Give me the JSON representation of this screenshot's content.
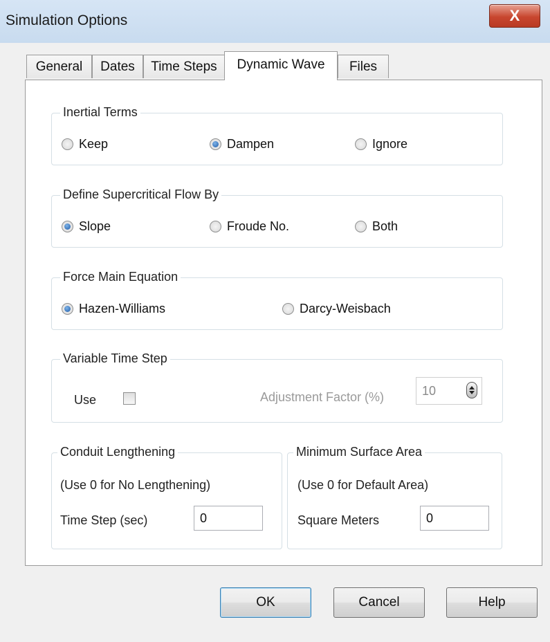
{
  "window": {
    "title": "Simulation Options",
    "close_label": "X"
  },
  "tabs": [
    {
      "label": "General",
      "active": false
    },
    {
      "label": "Dates",
      "active": false
    },
    {
      "label": "Time Steps",
      "active": false
    },
    {
      "label": "Dynamic Wave",
      "active": true
    },
    {
      "label": "Files",
      "active": false
    }
  ],
  "inertial_terms": {
    "label": "Inertial Terms",
    "options": [
      {
        "label": "Keep",
        "checked": false
      },
      {
        "label": "Dampen",
        "checked": true
      },
      {
        "label": "Ignore",
        "checked": false
      }
    ]
  },
  "supercritical": {
    "label": "Define Supercritical Flow By",
    "options": [
      {
        "label": "Slope",
        "checked": true
      },
      {
        "label": "Froude No.",
        "checked": false
      },
      {
        "label": "Both",
        "checked": false
      }
    ]
  },
  "force_main": {
    "label": "Force Main Equation",
    "options": [
      {
        "label": "Hazen-Williams",
        "checked": true
      },
      {
        "label": "Darcy-Weisbach",
        "checked": false
      }
    ]
  },
  "variable_time_step": {
    "label": "Variable Time Step",
    "use_label": "Use",
    "use_checked": false,
    "adjustment_label": "Adjustment Factor (%)",
    "adjustment_value": "10"
  },
  "conduit_lengthening": {
    "label": "Conduit Lengthening",
    "note": "(Use 0 for No Lengthening)",
    "field_label": "Time Step (sec)",
    "value": "0"
  },
  "min_surface_area": {
    "label": "Minimum Surface Area",
    "note": "(Use 0 for Default Area)",
    "field_label": "Square Meters",
    "value": "0"
  },
  "buttons": {
    "ok": "OK",
    "cancel": "Cancel",
    "help": "Help"
  },
  "colors": {
    "titlebar": "#c8dbef",
    "close_button": "#c8462f",
    "radio_checked": "#1d5aa8"
  }
}
